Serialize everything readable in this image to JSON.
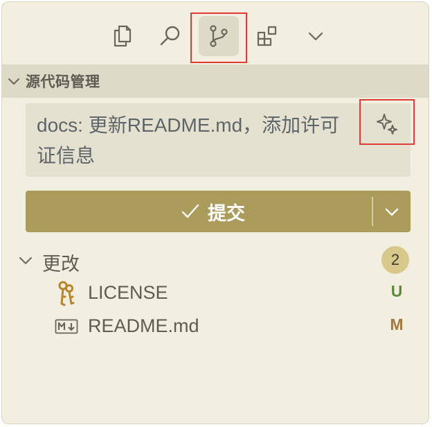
{
  "activity_bar": {
    "items": [
      {
        "name": "explorer",
        "icon": "files-icon",
        "active": false
      },
      {
        "name": "search",
        "icon": "search-icon",
        "active": false
      },
      {
        "name": "source-control",
        "icon": "source-control-icon",
        "active": true
      },
      {
        "name": "extensions",
        "icon": "extensions-icon",
        "active": false
      },
      {
        "name": "more",
        "icon": "chevron-down-icon",
        "active": false
      }
    ]
  },
  "section": {
    "title": "源代码管理"
  },
  "commit": {
    "message": "docs: 更新README.md，添加许可证信息",
    "generate_icon": "sparkle-icon",
    "button_label": "提交"
  },
  "changes": {
    "label": "更改",
    "count": "2",
    "files": [
      {
        "name": "LICENSE",
        "status": "U",
        "status_color": "#5a8a3a",
        "icon": "license-key-icon"
      },
      {
        "name": "README.md",
        "status": "M",
        "status_color": "#a27a3e",
        "icon": "markdown-icon"
      }
    ]
  },
  "colors": {
    "panel_bg": "#f2efe0",
    "header_bg": "#dedac8",
    "commit_button": "#ab9c5c",
    "badge": "#d9c88b",
    "highlight": "#e53a33"
  }
}
